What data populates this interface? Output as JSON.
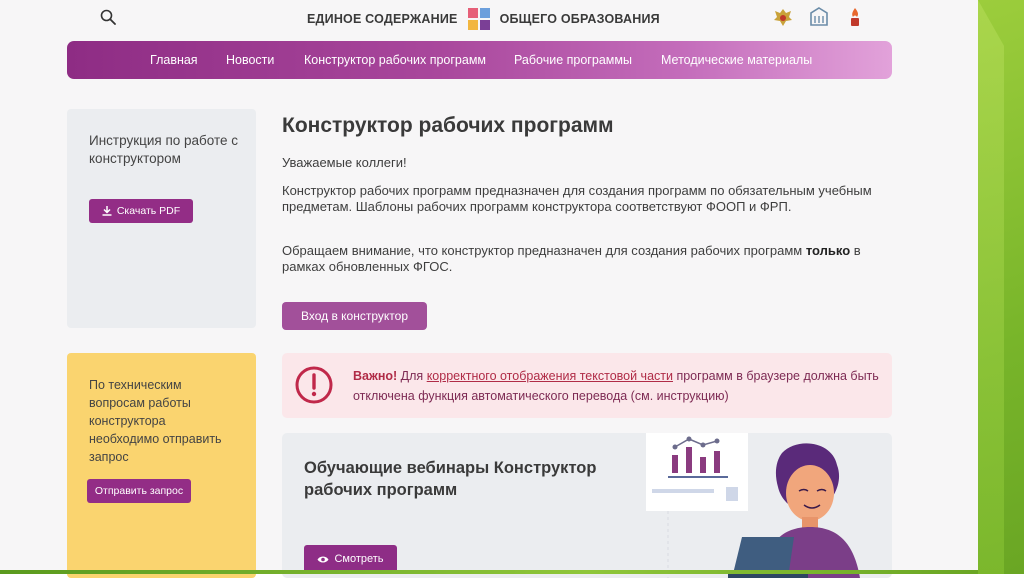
{
  "header": {
    "brand_left": "ЕДИНОЕ СОДЕРЖАНИЕ",
    "brand_right": "ОБЩЕГО ОБРАЗОВАНИЯ",
    "search_icon": "search-icon"
  },
  "nav": {
    "items": [
      {
        "label": "Главная"
      },
      {
        "label": "Новости"
      },
      {
        "label": "Конструктор рабочих программ"
      },
      {
        "label": "Рабочие программы"
      },
      {
        "label": "Методические материалы"
      }
    ]
  },
  "sidebar": {
    "instruction_text": "Инструкция по работе с конструктором",
    "download_label": "Скачать PDF",
    "support_text": "По техническим вопросам работы конструктора необходимо отправить запрос",
    "request_label": "Отправить запрос"
  },
  "main": {
    "title": "Конструктор рабочих программ",
    "greeting": "Уважаемые коллеги!",
    "p1": "Конструктор рабочих программ предназначен для создания программ по обязательным учебным предметам. Шаблоны рабочих программ конструктора  соответствуют ФООП и ФРП.",
    "p2_a": "Обращаем внимание, что  конструктор предназначен для создания рабочих программ ",
    "p2_bold": "только",
    "p2_b": " в рамках обновленных ФГОС.",
    "enter_label": "Вход в конструктор"
  },
  "alert": {
    "strong": "Важно!",
    "pre": " Для ",
    "link": "корректного отображения текстовой части",
    "post": " программ в браузере должна быть отключена функция автоматического перевода (см. инструкцию)"
  },
  "webinar": {
    "title": "Обучающие вебинары Конструктор рабочих программ",
    "watch_label": "Смотреть"
  },
  "colors": {
    "accent": "#932d86",
    "alert_bg": "#fbe7ea",
    "alert_red": "#b02c47",
    "yellow": "#fad46f"
  }
}
